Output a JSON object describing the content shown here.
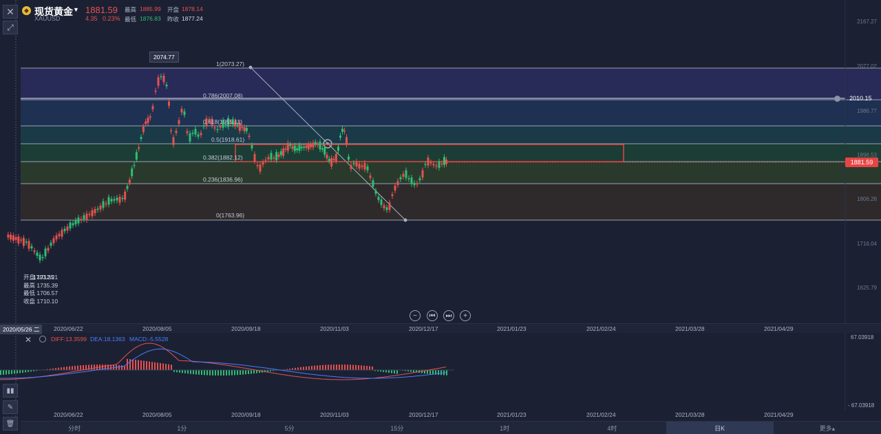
{
  "header": {
    "symbol_name": "现货黄金",
    "symbol_code": "XAUUSD",
    "price": "1881.59",
    "change": "4.35",
    "change_pct": "0.23%",
    "high_label": "最高",
    "high": "1885.99",
    "open_label": "开盘",
    "open": "1878.14",
    "low_label": "最低",
    "low": "1876.83",
    "prev_label": "昨收",
    "prev_close": "1877.24"
  },
  "y_axis": [
    "2167.27",
    "2077.02",
    "1986.77",
    "1896.53",
    "1806.28",
    "1716.04",
    "1625.79"
  ],
  "fib_levels": [
    {
      "label": "1(2073.27)"
    },
    {
      "label": "0.786(2007.08)"
    },
    {
      "label": "0.618(1955.11)"
    },
    {
      "label": "0.5(1918.61)"
    },
    {
      "label": "0.382(1882.12)"
    },
    {
      "label": "0.236(1836.96)"
    },
    {
      "label": "0(1763.96)"
    }
  ],
  "peak_label": "2074.77",
  "alert_value": "2010.15",
  "current_price_tag": "1881.59",
  "ohlc_overlay": {
    "open_line": "开盘 1712.21",
    "overlap_text": "1703.35",
    "high_line": "最高 1735.39",
    "low_line": "最低 1706.57",
    "close_line": "收盘 1710.10"
  },
  "zoom_controls": [
    "−",
    "⏮",
    "⏭",
    "+"
  ],
  "x_axis": {
    "current": "2020/05/26 二",
    "ticks": [
      "2020/06/22",
      "2020/08/05",
      "2020/09/18",
      "2020/11/03",
      "2020/12/17",
      "2021/01/23",
      "2021/02/24",
      "2021/03/28",
      "2021/04/29"
    ]
  },
  "macd": {
    "diff": "DIFF:13.3599",
    "dea": "DEA:18.1363",
    "macd": "MACD:-5.5528",
    "y_top": "67.03918",
    "y_bottom": "- 67.03918"
  },
  "periods": [
    "分时",
    "1分",
    "5分",
    "15分",
    "1时",
    "4时",
    "日K",
    "更多▴"
  ],
  "colors": {
    "up": "#e8514f",
    "down": "#2fbf71",
    "diff": "#e8514f",
    "dea": "#4a7dff"
  }
}
